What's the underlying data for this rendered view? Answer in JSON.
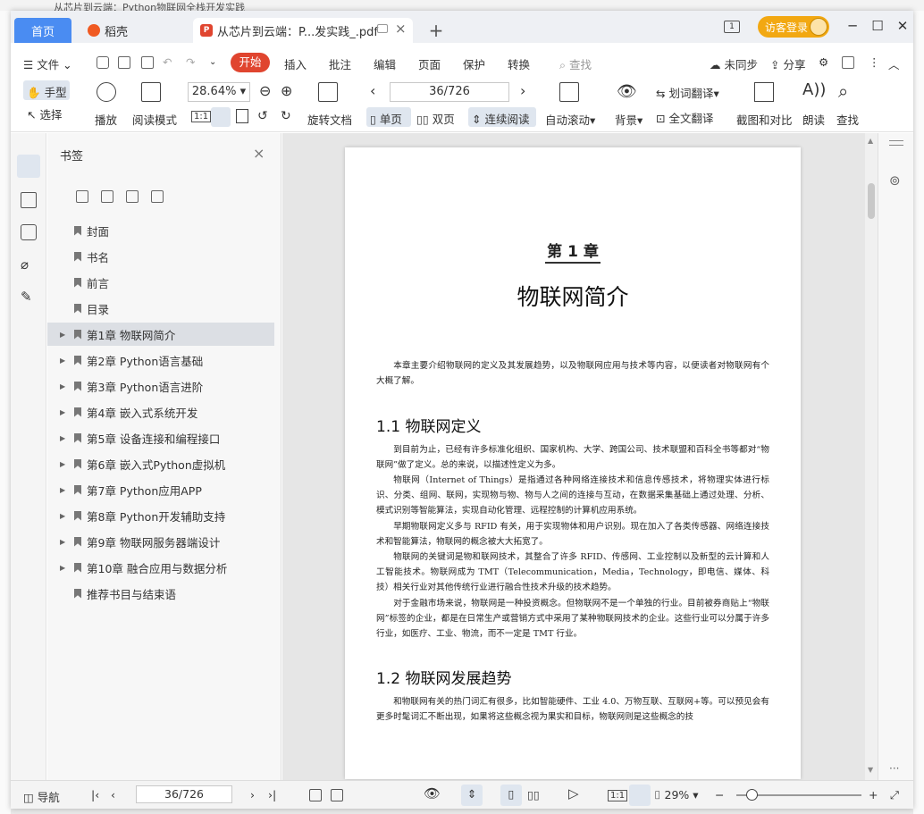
{
  "background": {
    "top_title": "从芯片到云端：Python物联网全栈开发实践"
  },
  "tabs": {
    "home": "首页",
    "daoke": "稻壳",
    "doc": "从芯片到云端：P...发实践_.pdf",
    "add": "+"
  },
  "titlebar": {
    "guest_login": "访客登录",
    "window_count": "1"
  },
  "menu": {
    "file": "文件",
    "start": "开始",
    "insert": "插入",
    "annotate": "批注",
    "edit": "编辑",
    "page": "页面",
    "protect": "保护",
    "convert": "转换",
    "search": "查找",
    "unsync": "未同步",
    "share": "分享"
  },
  "ribbon": {
    "hand": "手型",
    "select": "选择",
    "play": "播放",
    "read_mode": "阅读模式",
    "zoom": "28.64%",
    "rotate": "旋转文档",
    "page_counter": "36/726",
    "single": "单页",
    "double": "双页",
    "continuous": "连续阅读",
    "autoscroll": "自动滚动",
    "background": "背景",
    "word_translate": "划词翻译",
    "full_translate": "全文翻译",
    "screenshot_compare": "截图和对比",
    "read_aloud": "朗读",
    "find": "查找"
  },
  "bookmarks": {
    "title": "书签",
    "items": [
      {
        "label": "封面",
        "expandable": false,
        "selected": false
      },
      {
        "label": "书名",
        "expandable": false,
        "selected": false
      },
      {
        "label": "前言",
        "expandable": false,
        "selected": false
      },
      {
        "label": "目录",
        "expandable": false,
        "selected": false
      },
      {
        "label": "第1章 物联网简介",
        "expandable": true,
        "selected": true
      },
      {
        "label": "第2章 Python语言基础",
        "expandable": true,
        "selected": false
      },
      {
        "label": "第3章 Python语言进阶",
        "expandable": true,
        "selected": false
      },
      {
        "label": "第4章 嵌入式系统开发",
        "expandable": true,
        "selected": false
      },
      {
        "label": "第5章 设备连接和编程接口",
        "expandable": true,
        "selected": false
      },
      {
        "label": "第6章 嵌入式Python虚拟机",
        "expandable": true,
        "selected": false
      },
      {
        "label": "第7章 Python应用APP",
        "expandable": true,
        "selected": false
      },
      {
        "label": "第8章 Python开发辅助支持",
        "expandable": true,
        "selected": false
      },
      {
        "label": "第9章 物联网服务器端设计",
        "expandable": true,
        "selected": false
      },
      {
        "label": "第10章 融合应用与数据分析",
        "expandable": true,
        "selected": false
      },
      {
        "label": "推荐书目与结束语",
        "expandable": false,
        "selected": false
      }
    ]
  },
  "document": {
    "chapter_label": "第 1 章",
    "chapter_title": "物联网简介",
    "intro": "本章主要介绍物联网的定义及其发展趋势，以及物联网应用与技术等内容，以便读者对物联网有个大概了解。",
    "sec1_title": "1.1   物联网定义",
    "sec1_p1": "到目前为止，已经有许多标准化组织、国家机构、大学、跨国公司、技术联盟和百科全书等都对“物联网”做了定义。总的来说，以描述性定义为多。",
    "sec1_p2": "物联网（Internet of Things）是指通过各种网络连接技术和信息传感技术，将物理实体进行标识、分类、组网、联网，实现物与物、物与人之间的连接与互动，在数据采集基础上通过处理、分析、模式识别等智能算法，实现自动化管理、远程控制的计算机应用系统。",
    "sec1_p3": "早期物联网定义多与 RFID 有关，用于实现物体和用户识别。现在加入了各类传感器、网络连接技术和智能算法，物联网的概念被大大拓宽了。",
    "sec1_p4": "物联网的关键词是物和联网技术，其整合了许多 RFID、传感网、工业控制以及新型的云计算和人工智能技术。物联网成为 TMT（Telecommunication，Media，Technology，即电信、媒体、科技）相关行业对其他传统行业进行融合性技术升级的技术趋势。",
    "sec1_p5": "对于金融市场来说，物联网是一种投资概念。但物联网不是一个单独的行业。目前被券商贴上“物联网”标签的企业，都是在日常生产或营销方式中采用了某种物联网技术的企业。这些行业可以分属于许多行业，如医疗、工业、物流，而不一定是 TMT 行业。",
    "sec2_title": "1.2   物联网发展趋势",
    "sec2_p1": "和物联网有关的热门词汇有很多，比如智能硬件、工业 4.0、万物互联、互联网+等。可以预见会有更多时髦词汇不断出现，如果将这些概念视为果实和目标，物联网则是这些概念的技"
  },
  "statusbar": {
    "nav": "导航",
    "page_counter": "36/726",
    "zoom": "29%",
    "zoom_level": 0.12
  }
}
